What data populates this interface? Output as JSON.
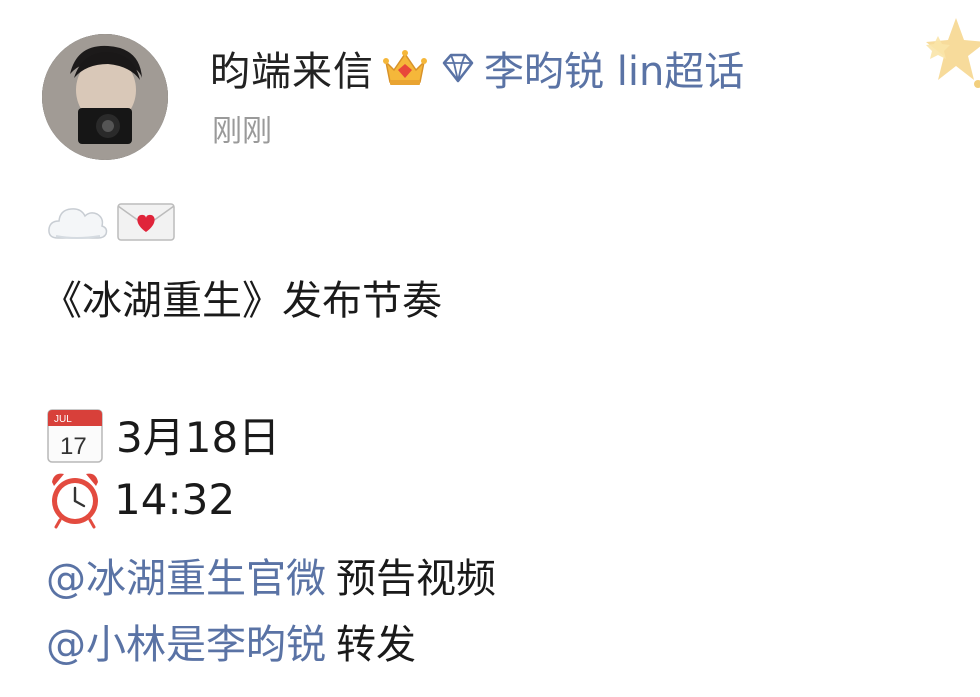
{
  "post": {
    "author": {
      "name": "昀端来信",
      "badge_icon": "crown-icon",
      "topic_icon": "diamond-icon",
      "topic_label": "李昀锐 lin超话"
    },
    "timestamp": "刚刚",
    "emoji_line": [
      "cloud-icon",
      "love-letter-icon"
    ],
    "title": "《冰湖重生》发布节奏",
    "schedule": {
      "date_icon": "calendar-icon",
      "date": "3月18日",
      "time_icon": "alarm-clock-icon",
      "time": "14:32"
    },
    "mentions": [
      {
        "handle": "@冰湖重生官微",
        "action": "预告视频"
      },
      {
        "handle": "@小林是李昀锐",
        "action": "转发"
      }
    ]
  },
  "colors": {
    "link": "#5a73a5",
    "text": "#1a1a1a",
    "muted": "#9a9a9a"
  }
}
